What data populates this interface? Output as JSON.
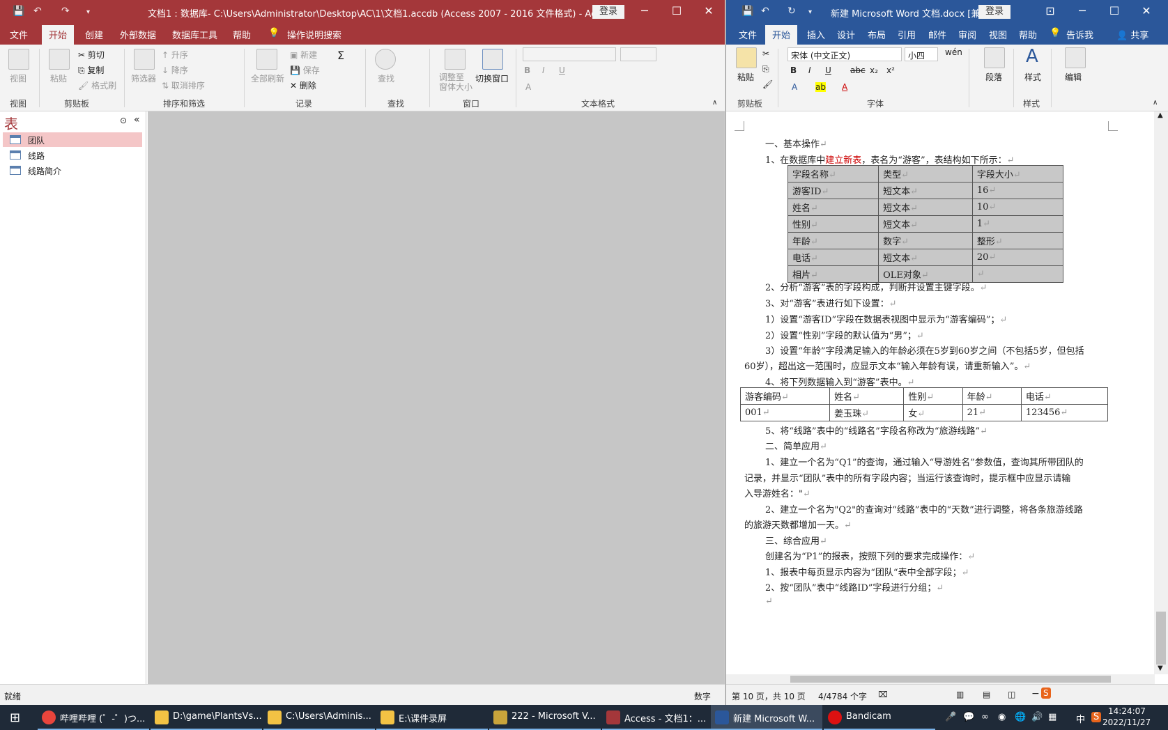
{
  "access": {
    "title": "文档1 : 数据库- C:\\Users\\Administrator\\Desktop\\AC\\1\\文档1.accdb (Access 2007 - 2016 文件格式)  -  Access",
    "login": "登录",
    "tabs": [
      "文件",
      "开始",
      "创建",
      "外部数据",
      "数据库工具",
      "帮助",
      "操作说明搜索"
    ],
    "ribbon": {
      "view": "视图",
      "paste": "粘贴",
      "cut": "剪切",
      "copy": "复制",
      "format_painter": "格式刷",
      "filter": "筛选器",
      "ascending": "升序",
      "descending": "降序",
      "remove_sort": "取消排序",
      "refresh_all": "全部刷新",
      "new": "新建",
      "save": "保存",
      "delete": "删除",
      "find": "查找",
      "fit_window": "调整至\n窗体大小",
      "switch_window": "切换窗口",
      "groups": [
        "视图",
        "剪贴板",
        "排序和筛选",
        "记录",
        "查找",
        "窗口",
        "文本格式"
      ]
    },
    "nav": {
      "title": "表",
      "items": [
        "团队",
        "线路",
        "线路简介"
      ]
    },
    "status": {
      "left": "就绪",
      "right": "数字"
    }
  },
  "word": {
    "title": "新建 Microsoft Word 文档.docx [兼容...",
    "login": "登录",
    "tabs": [
      "文件",
      "开始",
      "插入",
      "设计",
      "布局",
      "引用",
      "邮件",
      "审阅",
      "视图",
      "帮助",
      "告诉我",
      "共享"
    ],
    "ribbon": {
      "paste": "粘贴",
      "font": "宋体 (中文正文)",
      "size": "小四",
      "paragraph": "段落",
      "styles": "样式",
      "editing": "编辑",
      "groups": [
        "剪贴板",
        "字体",
        "样式"
      ]
    },
    "doc": {
      "l1": "一、基本操作",
      "l2a": "1、在数据库中",
      "l2b": "建立新表",
      "l2c": "，表名为“游客”，表结构如下所示：",
      "table1": [
        [
          "字段名称",
          "类型",
          "字段大小"
        ],
        [
          "游客ID",
          "短文本",
          "16"
        ],
        [
          "姓名",
          "短文本",
          "10"
        ],
        [
          "性别",
          "短文本",
          "1"
        ],
        [
          "年龄",
          "数字",
          "整形"
        ],
        [
          "电话",
          "短文本",
          "20"
        ],
        [
          "相片",
          "OLE对象",
          ""
        ]
      ],
      "l3": "2、分析“游客”表的字段构成，判断并设置主键字段。",
      "l4": "3、对“游客”表进行如下设置：",
      "l5": "1）设置“游客ID”字段在数据表视图中显示为“游客编码”；",
      "l6": "2）设置“性别”字段的默认值为“男”；",
      "l7": "3）设置“年龄”字段满足输入的年龄必须在5岁到60岁之间（不包括5岁，但包括",
      "l8": "60岁），超出这一范围时，应显示文本“输入年龄有误，请重新输入”。",
      "l9": "4、将下列数据输入到“游客”表中。",
      "table2": [
        [
          "游客编码",
          "姓名",
          "性别",
          "年龄",
          "电话"
        ],
        [
          "001",
          "姜玉珠",
          "女",
          "21",
          "123456"
        ]
      ],
      "l10": "5、将“线路”表中的“线路名”字段名称改为“旅游线路”",
      "l11": "二、简单应用",
      "l12": "1、建立一个名为“Q1”的查询，通过输入“导游姓名”参数值，查询其所带团队的",
      "l13": "记录，并显示“团队”表中的所有字段内容；当运行该查询时，提示框中应显示请输",
      "l14": "入导游姓名：\"",
      "l15": "2、建立一个名为\"Q2\"的查询对“线路”表中的“天数”进行调整，将各条旅游线路",
      "l16": "的旅游天数都增加一天。",
      "l17": "三、综合应用",
      "l18": "创建名为“P1”的报表，按照下列的要求完成操作：",
      "l19": "1、报表中每页显示内容为“团队“表中全部字段；",
      "l20": "2、按“团队”表中“线路ID”字段进行分组；"
    },
    "status": {
      "page": "第 10 页，共 10 页",
      "words": "4/4784 个字"
    }
  },
  "taskbar": {
    "items": [
      "哔哩哔哩 (゜-゜)つ...",
      "D:\\game\\PlantsVs...",
      "C:\\Users\\Adminis...",
      "E:\\课件录屏",
      "222 - Microsoft V...",
      "Access - 文档1：...",
      "新建 Microsoft W...",
      "Bandicam"
    ],
    "time": "14:24:07",
    "date": "2022/11/27",
    "ime": "中"
  },
  "colors": {
    "access": "#a4373a",
    "word": "#2b579a"
  }
}
